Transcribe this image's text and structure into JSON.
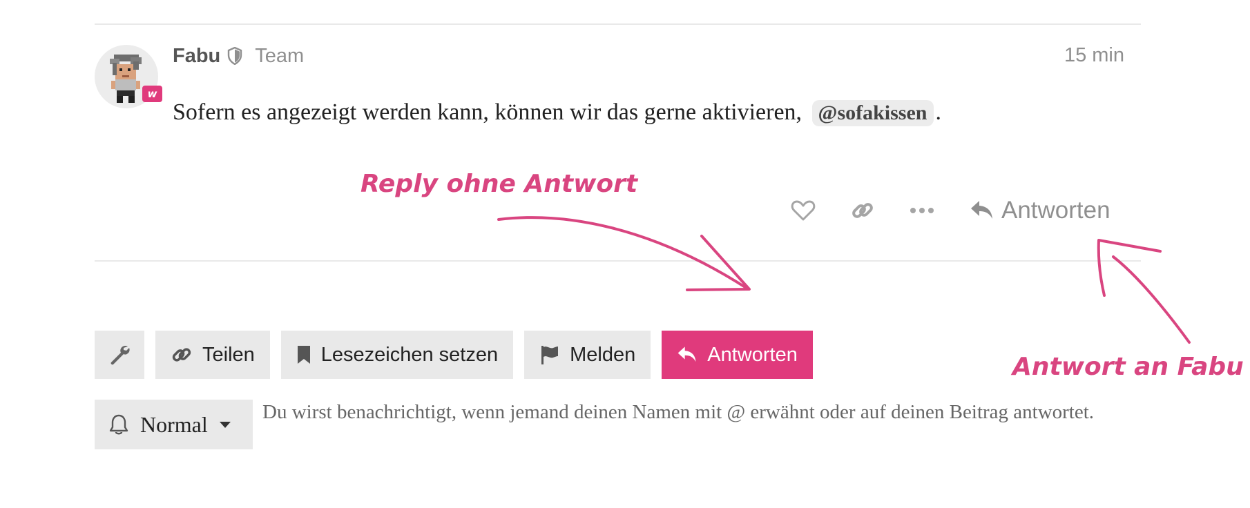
{
  "post": {
    "author": "Fabu",
    "group": "Team",
    "avatar_badge": "w",
    "time": "15 min",
    "body_text": "Sofern es angezeigt werden kann, können wir das gerne aktivieren,",
    "mention": "@sofakissen",
    "body_end": "."
  },
  "post_actions": {
    "like_icon": "heart-icon",
    "link_icon": "link-icon",
    "more_icon": "ellipsis-icon",
    "reply_label": "Antworten"
  },
  "annotations": {
    "left": "Reply ohne Antwort",
    "right": "Antwort an Fabu",
    "color": "#d94580"
  },
  "topic_footer": {
    "share_label": "Teilen",
    "bookmark_label": "Lesezeichen setzen",
    "flag_label": "Melden",
    "reply_label": "Antworten",
    "primary_color": "#e03a7c"
  },
  "notifications": {
    "level": "Normal",
    "description": "Du wirst benachrichtigt, wenn jemand deinen Namen mit @ erwähnt oder auf deinen Beitrag antwortet."
  }
}
